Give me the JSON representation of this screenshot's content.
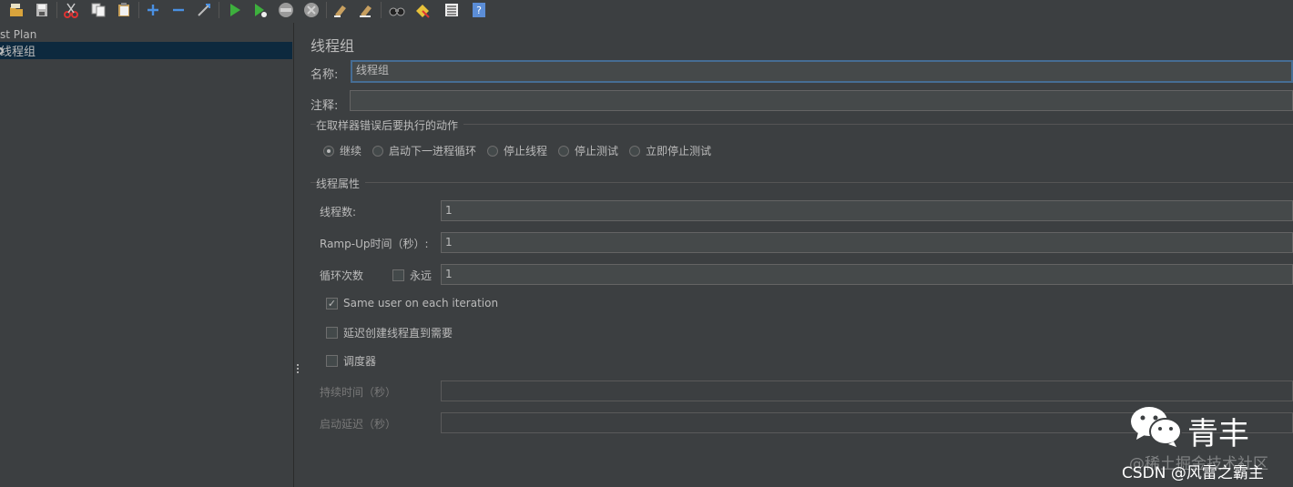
{
  "toolbar": {
    "buttons": [
      "open-icon",
      "save-icon",
      "cut-icon",
      "copy-icon",
      "paste-icon",
      "add-icon",
      "remove-icon",
      "toggle-icon",
      "start-icon",
      "start-no-pause-icon",
      "stop-icon",
      "shutdown-icon",
      "clear-icon",
      "clear-all-icon",
      "search-icon",
      "reset-search-icon",
      "function-helper-icon",
      "help-icon"
    ]
  },
  "tree": {
    "root_label": "st Plan",
    "selected_label": "线程组"
  },
  "panel": {
    "title": "线程组",
    "name_label": "名称:",
    "name_value": "线程组",
    "comment_label": "注释:",
    "comment_value": "",
    "error_action": {
      "legend": "在取样器错误后要执行的动作",
      "options": [
        "继续",
        "启动下一进程循环",
        "停止线程",
        "停止测试",
        "立即停止测试"
      ],
      "selected": "继续"
    },
    "thread_props": {
      "legend": "线程属性",
      "threads_label": "线程数:",
      "threads_value": "1",
      "rampup_label": "Ramp-Up时间（秒）:",
      "rampup_value": "1",
      "loop_label": "循环次数",
      "forever_label": "永远",
      "forever_checked": false,
      "loop_value": "1",
      "same_user_label": "Same user on each iteration",
      "same_user_checked": true,
      "delay_label": "延迟创建线程直到需要",
      "delay_checked": false,
      "scheduler_label": "调度器",
      "scheduler_checked": false,
      "duration_label": "持续时间（秒）",
      "duration_value": "",
      "startup_delay_label": "启动延迟（秒）",
      "startup_delay_value": ""
    }
  },
  "watermark": {
    "name": "青丰",
    "site": "@稀土掘金技术社区",
    "csdn": "CSDN @风雷之霸主"
  },
  "colors": {
    "background": "#3c3f41",
    "selection": "#0d293e",
    "text": "#bbbbbb",
    "focus_border": "#466d94"
  }
}
